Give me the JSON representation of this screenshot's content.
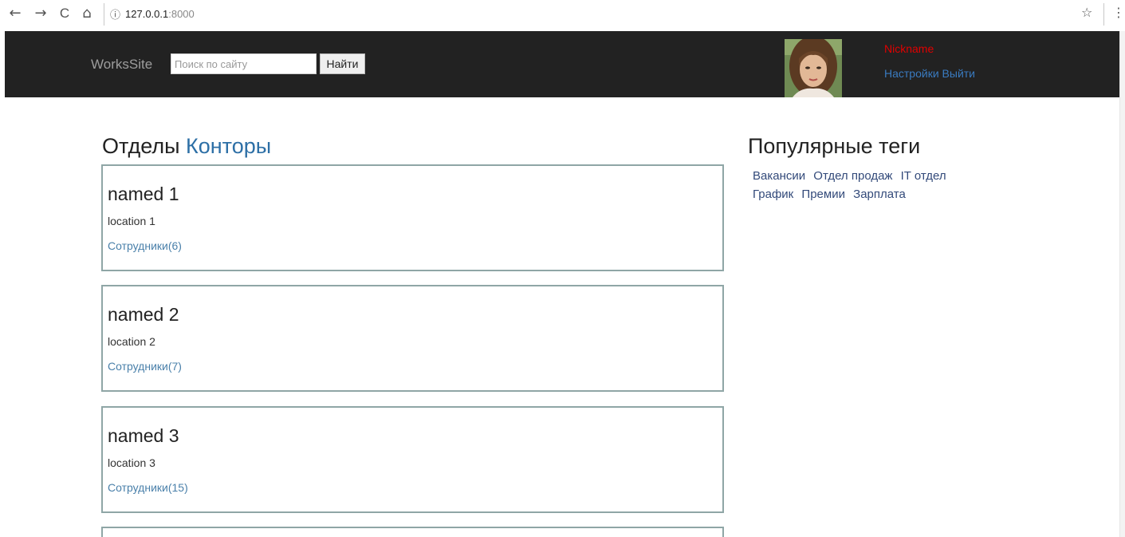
{
  "browser": {
    "url_host": "127.0.0.1",
    "url_port": ":8000",
    "info_glyph": "ⓘ",
    "back_glyph": "←",
    "forward_glyph": "→",
    "reload_glyph": "C",
    "home_glyph": "⌂",
    "star_glyph": "☆",
    "menu_glyph": "⋮"
  },
  "header": {
    "brand": "WorksSite",
    "search_placeholder": "Поиск по сайту",
    "search_button": "Найти",
    "nickname": "Nickname",
    "settings_link": "Настройки",
    "logout_link": "Выйти"
  },
  "main": {
    "title_static": "Отделы",
    "title_active": "Конторы",
    "cards": [
      {
        "name": "named 1",
        "location": "location 1",
        "employees": "Сотрудники(6)"
      },
      {
        "name": "named 2",
        "location": "location 2",
        "employees": "Сотрудники(7)"
      },
      {
        "name": "named 3",
        "location": "location 3",
        "employees": "Сотрудники(15)"
      }
    ]
  },
  "sidebar": {
    "title": "Популярные теги",
    "tags": [
      "Вакансии",
      "Отдел продаж",
      "IT отдел",
      "График",
      "Премии",
      "Зарплата"
    ]
  },
  "colors": {
    "header_bg": "#222222",
    "nickname": "#e00000",
    "link": "#3a7bc0",
    "card_border": "#8fa6a6"
  }
}
